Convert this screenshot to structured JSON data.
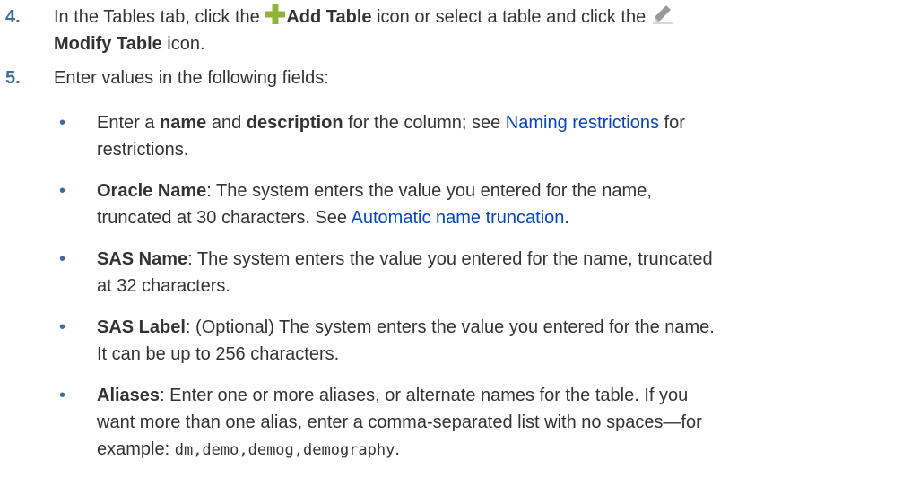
{
  "step4": {
    "number": "4.",
    "t1": "In the Tables tab, click the ",
    "add_label": "Add Table",
    "t2": " icon or select a table and click the ",
    "modify_label": "Modify Table",
    "t3": " icon.",
    "icons": {
      "add": "plus-icon",
      "modify": "pencil-icon"
    },
    "colors": {
      "add_icon": "#8fb43a",
      "modify_icon": "#8a8a8a"
    }
  },
  "step5": {
    "number": "5.",
    "text": "Enter values in the following fields:"
  },
  "bullets": [
    {
      "t1": "Enter a ",
      "b1": "name",
      "t2": " and ",
      "b2": "description",
      "t3": " for the column; see ",
      "link": "Naming restrictions",
      "t4": " for",
      "line2": "restrictions."
    },
    {
      "bold": "Oracle Name",
      "t1": ": The system enters the value you entered for the name,",
      "line2": "truncated at 30 characters. See ",
      "link": "Automatic name truncation",
      "t2": "."
    },
    {
      "bold": "SAS Name",
      "t1": ": The system enters the value you entered for the name, truncated",
      "line2": "at 32 characters."
    },
    {
      "bold": "SAS Label",
      "t1": ": (Optional) The system enters the value you entered for the name.",
      "line2": "It can be up to 256 characters."
    },
    {
      "bold": "Aliases",
      "t1": ": Enter one or more aliases, or alternate names for the table. If you",
      "line2": "want more than one alias, enter a comma-separated list with no spaces—for",
      "line3": "example: ",
      "code": "dm,demo,demog,demography",
      "t2": "."
    }
  ],
  "colors": {
    "number": "#3e6d9c",
    "link": "#0645c2",
    "text": "#333333"
  }
}
